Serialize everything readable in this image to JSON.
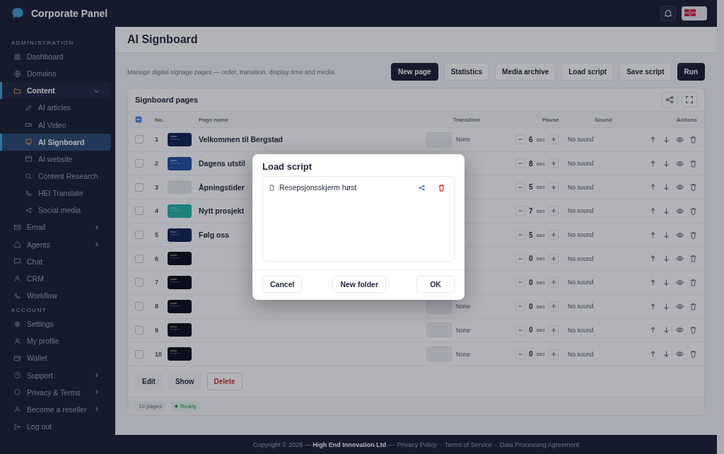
{
  "app": {
    "title": "Corporate Panel"
  },
  "sidebar": {
    "sections": [
      {
        "heading": "ADMINISTRATION",
        "items": [
          {
            "label": "Dashboard",
            "selected": false
          },
          {
            "label": "Domains",
            "selected": false
          },
          {
            "label": "Content",
            "selected": false,
            "expanded": true,
            "children": [
              {
                "label": "AI articles",
                "selected": false
              },
              {
                "label": "AI Video",
                "selected": false
              },
              {
                "label": "AI Signboard",
                "selected": true
              },
              {
                "label": "AI website",
                "selected": false
              },
              {
                "label": "Content Research",
                "selected": false
              },
              {
                "label": "HEI Translate",
                "selected": false
              },
              {
                "label": "Social media",
                "selected": false
              }
            ]
          },
          {
            "label": "Email",
            "selected": false,
            "expanded": false
          },
          {
            "label": "Agents",
            "selected": false,
            "expanded": false
          },
          {
            "label": "Chat",
            "selected": false
          },
          {
            "label": "CRM",
            "selected": false
          },
          {
            "label": "Workflow",
            "selected": false
          }
        ]
      },
      {
        "heading": "ACCOUNT",
        "items": [
          {
            "label": "Settings",
            "selected": false
          },
          {
            "label": "My profile",
            "selected": false
          },
          {
            "label": "Wallet",
            "selected": false
          },
          {
            "label": "Support",
            "selected": false,
            "expanded": false
          },
          {
            "label": "Privacy & Terms",
            "selected": false,
            "expanded": false
          },
          {
            "label": "Become a reseller",
            "selected": false,
            "expanded": false
          },
          {
            "label": "Log out",
            "selected": false
          }
        ]
      }
    ]
  },
  "page": {
    "title": "AI Signboard",
    "description": "Manage digital signage pages — order, transition, display time and media.",
    "toolbar": [
      {
        "label": "New page",
        "kind": "primary"
      },
      {
        "label": "Statistics",
        "kind": "plain"
      },
      {
        "label": "Media archive",
        "kind": "plain"
      },
      {
        "label": "Load script",
        "kind": "plain"
      },
      {
        "label": "Save script",
        "kind": "plain"
      },
      {
        "label": "Run",
        "kind": "primary"
      }
    ]
  },
  "table": {
    "title": "Signboard pages",
    "select_all": {
      "indeterminate": true
    },
    "columns": [
      "No.",
      "Page name",
      "Transition",
      "Pause",
      "Sound",
      "Actions"
    ],
    "rows": [
      {
        "no": "1",
        "name": "Velkommen til Bergstad",
        "transition": "None",
        "pause": "6",
        "unit": "sec",
        "sound": "No sound",
        "checked": false
      },
      {
        "no": "2",
        "name": "Dagens utstil",
        "pause": "8",
        "unit": "sec",
        "sound": "No sound",
        "checked": false
      },
      {
        "no": "3",
        "name": "Åpningstider",
        "pause": "5",
        "unit": "sec",
        "sound": "No sound",
        "checked": false
      },
      {
        "no": "4",
        "name": "Nytt prosjekt",
        "pause": "7",
        "unit": "sec",
        "sound": "No sound",
        "checked": false
      },
      {
        "no": "5",
        "name": "Følg oss",
        "pause": "5",
        "unit": "sec",
        "sound": "No sound",
        "checked": false
      },
      {
        "no": "6",
        "pause": "0",
        "unit": "sec",
        "sound": "No sound",
        "checked": false
      },
      {
        "no": "7",
        "pause": "0",
        "unit": "sec",
        "sound": "No sound",
        "checked": false
      },
      {
        "no": "8",
        "transition": "None",
        "pause": "0",
        "unit": "sec",
        "sound": "No sound",
        "checked": false
      },
      {
        "no": "9",
        "transition": "None",
        "pause": "0",
        "unit": "sec",
        "sound": "No sound",
        "checked": false
      },
      {
        "no": "10",
        "transition": "None",
        "pause": "0",
        "unit": "sec",
        "sound": "No sound",
        "checked": false
      }
    ],
    "actions": [
      {
        "label": "Edit",
        "kind": "plain"
      },
      {
        "label": "Show",
        "kind": "plain"
      },
      {
        "label": "Delete",
        "kind": "danger"
      }
    ],
    "count": "10 pages",
    "status": "Ready"
  },
  "footer": {
    "copyright": "Copyright © 2026 — **High End Innovation Ltd** —",
    "links": [
      "Privacy Policy",
      "Terms of Service",
      "Data Processing Agreement"
    ],
    "separators": [
      "·",
      "·"
    ]
  },
  "dialog": {
    "title": "Load script",
    "files": [
      {
        "name": "Resepsjonsskjerm høst"
      }
    ],
    "buttons": [
      {
        "label": "Cancel",
        "kind": "cancel"
      },
      {
        "label": "New folder",
        "kind": "folder"
      },
      {
        "label": "OK",
        "kind": "ok"
      }
    ]
  }
}
